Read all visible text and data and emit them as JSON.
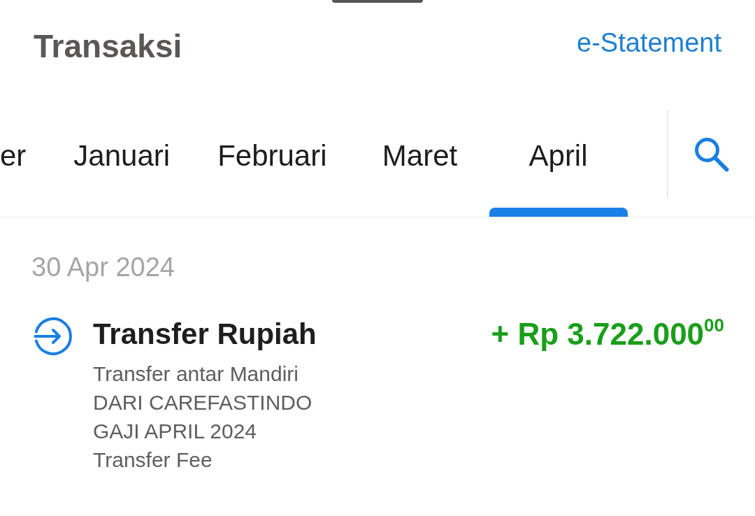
{
  "header": {
    "title": "Transaksi",
    "link": "e-Statement"
  },
  "tabs": [
    {
      "label": "er",
      "selected": false
    },
    {
      "label": "Januari",
      "selected": false
    },
    {
      "label": "Februari",
      "selected": false
    },
    {
      "label": "Maret",
      "selected": false
    },
    {
      "label": "April",
      "selected": true
    }
  ],
  "groups": [
    {
      "date": "30 Apr 2024",
      "transactions": [
        {
          "kind": "incoming",
          "title": "Transfer Rupiah",
          "details": [
            "Transfer antar Mandiri",
            "DARI CAREFASTINDO",
            "GAJI APRIL 2024",
            "Transfer Fee"
          ],
          "amount": "+ Rp 3.722.000$^{00}$"
        }
      ]
    }
  ]
}
